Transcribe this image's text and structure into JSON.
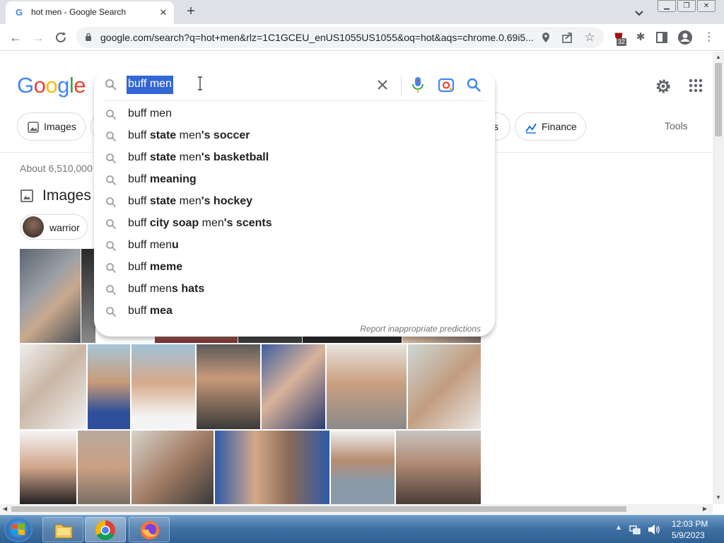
{
  "browser": {
    "tab_title": "hot men - Google Search",
    "tab_favicon": "G",
    "new_tab_glyph": "+",
    "close_glyph": "✕",
    "url": "google.com/search?q=hot+men&rlz=1C1GCEU_enUS1055US1055&oq=hot&aqs=chrome.0.69i5...",
    "extension_badge": "32"
  },
  "google": {
    "logo_letters": [
      {
        "ch": "G",
        "color": "#4285f4"
      },
      {
        "ch": "o",
        "color": "#ea4335"
      },
      {
        "ch": "o",
        "color": "#fbbc05"
      },
      {
        "ch": "g",
        "color": "#4285f4"
      },
      {
        "ch": "l",
        "color": "#34a853"
      },
      {
        "ch": "e",
        "color": "#ea4335"
      }
    ],
    "chips": {
      "images": "Images",
      "news_tail": "s",
      "finance": "Finance"
    },
    "tools": "Tools",
    "result_stats": "About 6,510,000",
    "images_heading": "Images",
    "warrior_chip": "warrior"
  },
  "search": {
    "query": "buff men",
    "suggestions": [
      {
        "prefix": "buff men",
        "parts": []
      },
      {
        "prefix": "buff ",
        "parts": [
          {
            "t": "state",
            "b": true
          },
          {
            "t": " men",
            "b": false
          },
          {
            "t": "'s soccer",
            "b": true
          }
        ]
      },
      {
        "prefix": "buff ",
        "parts": [
          {
            "t": "state",
            "b": true
          },
          {
            "t": " men",
            "b": false
          },
          {
            "t": "'s basketball",
            "b": true
          }
        ]
      },
      {
        "prefix": "buff ",
        "parts": [
          {
            "t": "meaning",
            "b": true
          }
        ]
      },
      {
        "prefix": "buff ",
        "parts": [
          {
            "t": "state",
            "b": true
          },
          {
            "t": " men",
            "b": false
          },
          {
            "t": "'s hockey",
            "b": true
          }
        ]
      },
      {
        "prefix": "buff ",
        "parts": [
          {
            "t": "city soap",
            "b": true
          },
          {
            "t": " men",
            "b": false
          },
          {
            "t": "'s scents",
            "b": true
          }
        ]
      },
      {
        "prefix": "buff men",
        "parts": [
          {
            "t": "u",
            "b": true
          }
        ]
      },
      {
        "prefix": "buff ",
        "parts": [
          {
            "t": "meme",
            "b": true
          }
        ]
      },
      {
        "prefix": "buff men",
        "parts": [
          {
            "t": "s hats",
            "b": true
          }
        ]
      },
      {
        "prefix": "buff ",
        "parts": [
          {
            "t": "mea",
            "b": true
          }
        ]
      }
    ],
    "report_link": "Report inappropriate predictions"
  },
  "taskbar": {
    "time": "12:03 PM",
    "date": "5/9/2023"
  },
  "colors": {
    "selection": "#3367d6",
    "google_blue": "#4285f4",
    "taskbar": "#3d6fa3"
  }
}
